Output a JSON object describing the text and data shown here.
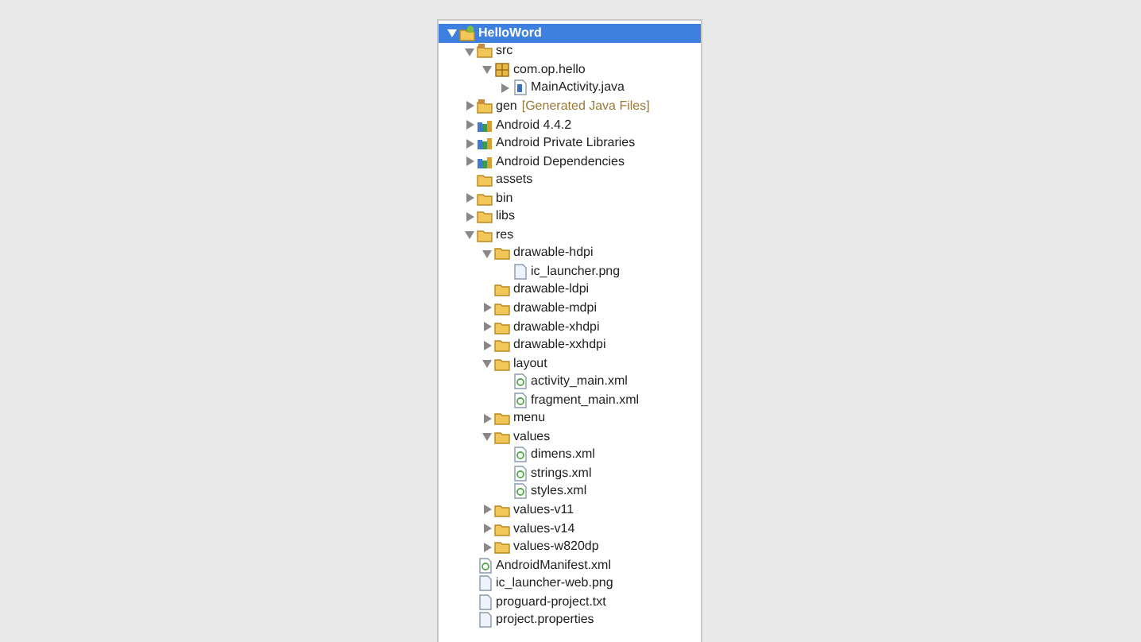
{
  "tree": [
    {
      "label": "HelloWord",
      "kind": "project",
      "expanded": true,
      "selected": true,
      "children": [
        {
          "label": "src",
          "kind": "source-folder",
          "expanded": true,
          "selected": false,
          "children": [
            {
              "label": "com.op.hello",
              "kind": "package",
              "expanded": true,
              "selected": false,
              "children": [
                {
                  "label": "MainActivity.java",
                  "kind": "java-file",
                  "expanded": false,
                  "selected": false
                }
              ]
            }
          ]
        },
        {
          "label": "gen",
          "decoration": "[Generated Java Files]",
          "kind": "source-folder",
          "expanded": false,
          "selected": false
        },
        {
          "label": "Android 4.4.2",
          "kind": "library",
          "expanded": false,
          "selected": false
        },
        {
          "label": "Android Private Libraries",
          "kind": "library",
          "expanded": false,
          "selected": false
        },
        {
          "label": "Android Dependencies",
          "kind": "library",
          "expanded": false,
          "selected": false
        },
        {
          "label": "assets",
          "kind": "folder",
          "selected": false
        },
        {
          "label": "bin",
          "kind": "folder",
          "expanded": false,
          "selected": false
        },
        {
          "label": "libs",
          "kind": "folder",
          "expanded": false,
          "selected": false
        },
        {
          "label": "res",
          "kind": "folder",
          "expanded": true,
          "selected": false,
          "children": [
            {
              "label": "drawable-hdpi",
              "kind": "folder",
              "expanded": true,
              "selected": false,
              "children": [
                {
                  "label": "ic_launcher.png",
                  "kind": "file",
                  "selected": false
                }
              ]
            },
            {
              "label": "drawable-ldpi",
              "kind": "folder",
              "selected": false
            },
            {
              "label": "drawable-mdpi",
              "kind": "folder",
              "expanded": false,
              "selected": false
            },
            {
              "label": "drawable-xhdpi",
              "kind": "folder",
              "expanded": false,
              "selected": false
            },
            {
              "label": "drawable-xxhdpi",
              "kind": "folder",
              "expanded": false,
              "selected": false
            },
            {
              "label": "layout",
              "kind": "folder",
              "expanded": true,
              "selected": false,
              "children": [
                {
                  "label": "activity_main.xml",
                  "kind": "xml-file",
                  "selected": false
                },
                {
                  "label": "fragment_main.xml",
                  "kind": "xml-file",
                  "selected": false
                }
              ]
            },
            {
              "label": "menu",
              "kind": "folder",
              "expanded": false,
              "selected": false
            },
            {
              "label": "values",
              "kind": "folder",
              "expanded": true,
              "selected": false,
              "children": [
                {
                  "label": "dimens.xml",
                  "kind": "xml-file",
                  "selected": false
                },
                {
                  "label": "strings.xml",
                  "kind": "xml-file",
                  "selected": false
                },
                {
                  "label": "styles.xml",
                  "kind": "xml-file",
                  "selected": false
                }
              ]
            },
            {
              "label": "values-v11",
              "kind": "folder",
              "expanded": false,
              "selected": false
            },
            {
              "label": "values-v14",
              "kind": "folder",
              "expanded": false,
              "selected": false
            },
            {
              "label": "values-w820dp",
              "kind": "folder",
              "expanded": false,
              "selected": false
            }
          ]
        },
        {
          "label": "AndroidManifest.xml",
          "kind": "xml-file",
          "selected": false
        },
        {
          "label": "ic_launcher-web.png",
          "kind": "file",
          "selected": false
        },
        {
          "label": "proguard-project.txt",
          "kind": "file",
          "selected": false
        },
        {
          "label": "project.properties",
          "kind": "file",
          "selected": false
        }
      ]
    }
  ]
}
